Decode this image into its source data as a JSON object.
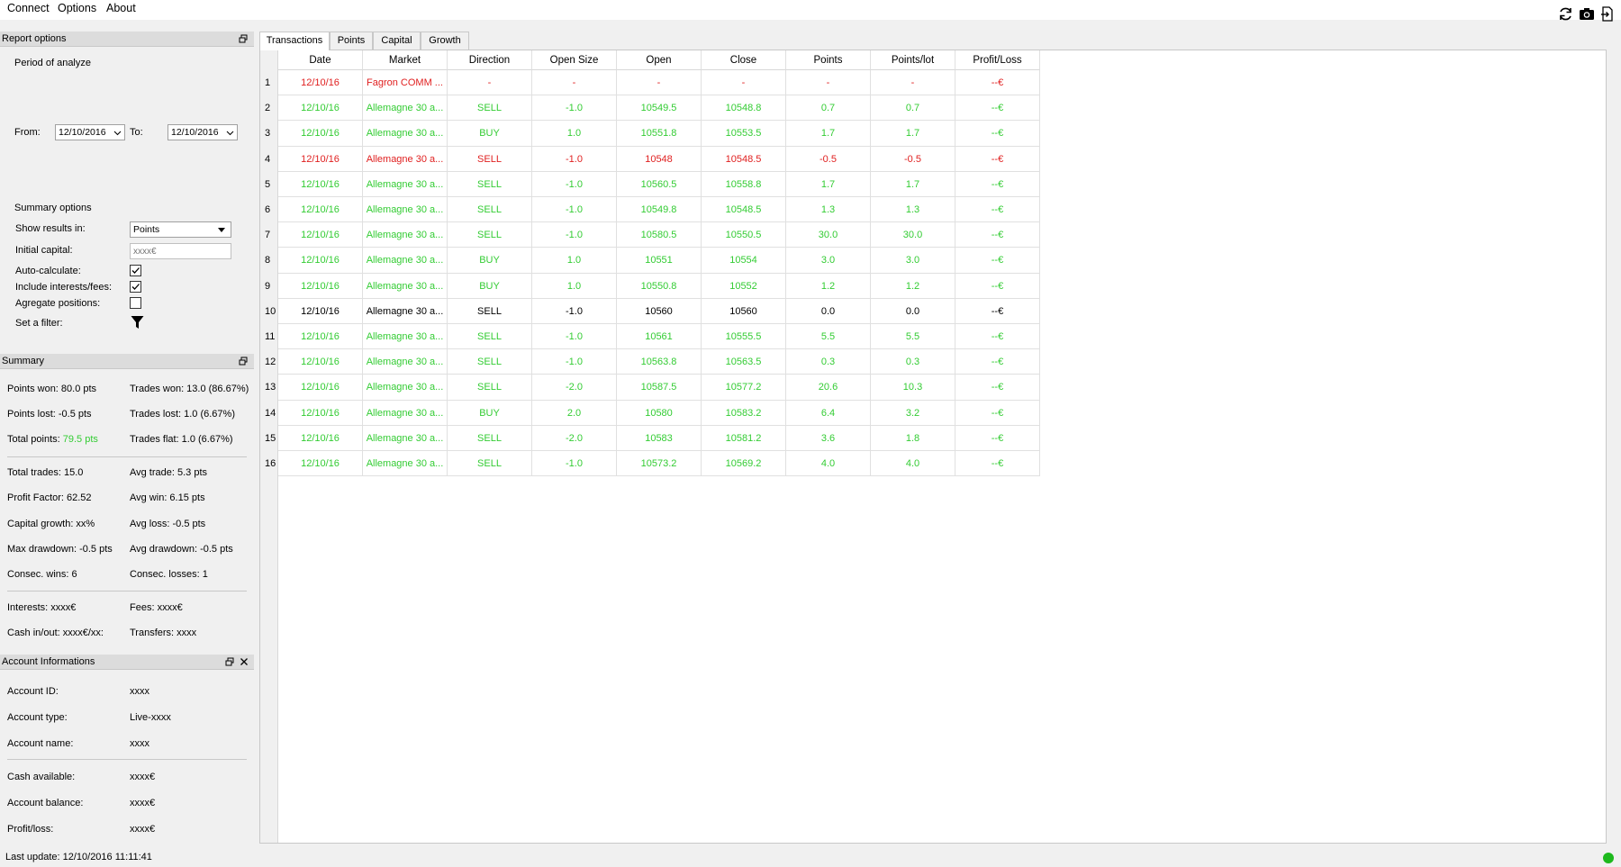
{
  "menu": [
    "Connect",
    "Options",
    "About"
  ],
  "toolbar_icons": [
    "refresh-icon",
    "camera-icon",
    "export-icon"
  ],
  "report_options": {
    "title": "Report options",
    "period_label": "Period of analyze",
    "from_label": "From:",
    "from_value": "12/10/2016",
    "to_label": "To:",
    "to_value": "12/10/2016",
    "summary_options_label": "Summary options",
    "show_results_label": "Show results in:",
    "show_results_value": "Points",
    "initial_capital_label": "Initial capital:",
    "initial_capital_placeholder": "xxxx€",
    "auto_calculate_label": "Auto-calculate:",
    "auto_calculate_checked": true,
    "include_fees_label": "Include interests/fees:",
    "include_fees_checked": true,
    "aggregate_label": "Agregate positions:",
    "aggregate_checked": false,
    "filter_label": "Set a filter:"
  },
  "summary": {
    "title": "Summary",
    "points_won": "Points won: 80.0 pts",
    "trades_won": "Trades won: 13.0 (86.67%)",
    "points_lost": "Points lost: -0.5 pts",
    "trades_lost": "Trades lost: 1.0 (6.67%)",
    "total_points_label": "Total points:",
    "total_points_value": "79.5 pts",
    "trades_flat": "Trades flat: 1.0 (6.67%)",
    "total_trades": "Total trades: 15.0",
    "avg_trade": "Avg trade: 5.3 pts",
    "profit_factor": "Profit Factor: 62.52",
    "avg_win": "Avg win: 6.15 pts",
    "capital_growth": "Capital growth: xx%",
    "avg_loss": "Avg loss: -0.5 pts",
    "max_drawdown": "Max drawdown: -0.5 pts",
    "avg_drawdown": "Avg drawdown: -0.5 pts",
    "consec_wins": "Consec. wins: 6",
    "consec_losses": "Consec. losses: 1",
    "interests": "Interests: xxxx€",
    "fees": "Fees: xxxx€",
    "cash_inout": "Cash in/out: xxxx€/xx:",
    "transfers": "Transfers: xxxx"
  },
  "account": {
    "title": "Account Informations",
    "id_label": "Account ID:",
    "id_value": "xxxx",
    "type_label": "Account type:",
    "type_value": "Live-xxxx",
    "name_label": "Account name:",
    "name_value": "xxxx",
    "cash_label": "Cash available:",
    "cash_value": "xxxx€",
    "balance_label": "Account balance:",
    "balance_value": "xxxx€",
    "pl_label": "Profit/loss:",
    "pl_value": "xxxx€"
  },
  "tabs": [
    "Transactions",
    "Points",
    "Capital",
    "Growth"
  ],
  "active_tab": "Transactions",
  "table": {
    "columns": [
      "Date",
      "Market",
      "Direction",
      "Open Size",
      "Open",
      "Close",
      "Points",
      "Points/lot",
      "Profit/Loss"
    ],
    "colors": {
      "green": "#33cc33",
      "red": "#e02020",
      "black": "#000000"
    },
    "rows": [
      {
        "n": "1",
        "color": "red",
        "cells": [
          "12/10/16",
          "Fagron COMM ...",
          "-",
          "-",
          "-",
          "-",
          "-",
          "-",
          "--€"
        ]
      },
      {
        "n": "2",
        "color": "green",
        "cells": [
          "12/10/16",
          "Allemagne 30 a...",
          "SELL",
          "-1.0",
          "10549.5",
          "10548.8",
          "0.7",
          "0.7",
          "--€"
        ]
      },
      {
        "n": "3",
        "color": "green",
        "cells": [
          "12/10/16",
          "Allemagne 30 a...",
          "BUY",
          "1.0",
          "10551.8",
          "10553.5",
          "1.7",
          "1.7",
          "--€"
        ]
      },
      {
        "n": "4",
        "color": "red",
        "cells": [
          "12/10/16",
          "Allemagne 30 a...",
          "SELL",
          "-1.0",
          "10548",
          "10548.5",
          "-0.5",
          "-0.5",
          "--€"
        ]
      },
      {
        "n": "5",
        "color": "green",
        "cells": [
          "12/10/16",
          "Allemagne 30 a...",
          "SELL",
          "-1.0",
          "10560.5",
          "10558.8",
          "1.7",
          "1.7",
          "--€"
        ]
      },
      {
        "n": "6",
        "color": "green",
        "cells": [
          "12/10/16",
          "Allemagne 30 a...",
          "SELL",
          "-1.0",
          "10549.8",
          "10548.5",
          "1.3",
          "1.3",
          "--€"
        ]
      },
      {
        "n": "7",
        "color": "green",
        "cells": [
          "12/10/16",
          "Allemagne 30 a...",
          "SELL",
          "-1.0",
          "10580.5",
          "10550.5",
          "30.0",
          "30.0",
          "--€"
        ]
      },
      {
        "n": "8",
        "color": "green",
        "cells": [
          "12/10/16",
          "Allemagne 30 a...",
          "BUY",
          "1.0",
          "10551",
          "10554",
          "3.0",
          "3.0",
          "--€"
        ]
      },
      {
        "n": "9",
        "color": "green",
        "cells": [
          "12/10/16",
          "Allemagne 30 a...",
          "BUY",
          "1.0",
          "10550.8",
          "10552",
          "1.2",
          "1.2",
          "--€"
        ]
      },
      {
        "n": "10",
        "color": "black",
        "cells": [
          "12/10/16",
          "Allemagne 30 a...",
          "SELL",
          "-1.0",
          "10560",
          "10560",
          "0.0",
          "0.0",
          "--€"
        ]
      },
      {
        "n": "11",
        "color": "green",
        "cells": [
          "12/10/16",
          "Allemagne 30 a...",
          "SELL",
          "-1.0",
          "10561",
          "10555.5",
          "5.5",
          "5.5",
          "--€"
        ]
      },
      {
        "n": "12",
        "color": "green",
        "cells": [
          "12/10/16",
          "Allemagne 30 a...",
          "SELL",
          "-1.0",
          "10563.8",
          "10563.5",
          "0.3",
          "0.3",
          "--€"
        ]
      },
      {
        "n": "13",
        "color": "green",
        "cells": [
          "12/10/16",
          "Allemagne 30 a...",
          "SELL",
          "-2.0",
          "10587.5",
          "10577.2",
          "20.6",
          "10.3",
          "--€"
        ]
      },
      {
        "n": "14",
        "color": "green",
        "cells": [
          "12/10/16",
          "Allemagne 30 a...",
          "BUY",
          "2.0",
          "10580",
          "10583.2",
          "6.4",
          "3.2",
          "--€"
        ]
      },
      {
        "n": "15",
        "color": "green",
        "cells": [
          "12/10/16",
          "Allemagne 30 a...",
          "SELL",
          "-2.0",
          "10583",
          "10581.2",
          "3.6",
          "1.8",
          "--€"
        ]
      },
      {
        "n": "16",
        "color": "green",
        "cells": [
          "12/10/16",
          "Allemagne 30 a...",
          "SELL",
          "-1.0",
          "10573.2",
          "10569.2",
          "4.0",
          "4.0",
          "--€"
        ]
      }
    ]
  },
  "status": {
    "last_update": "Last update: 12/10/2016 11:11:41",
    "connection_color": "#1db91d"
  }
}
